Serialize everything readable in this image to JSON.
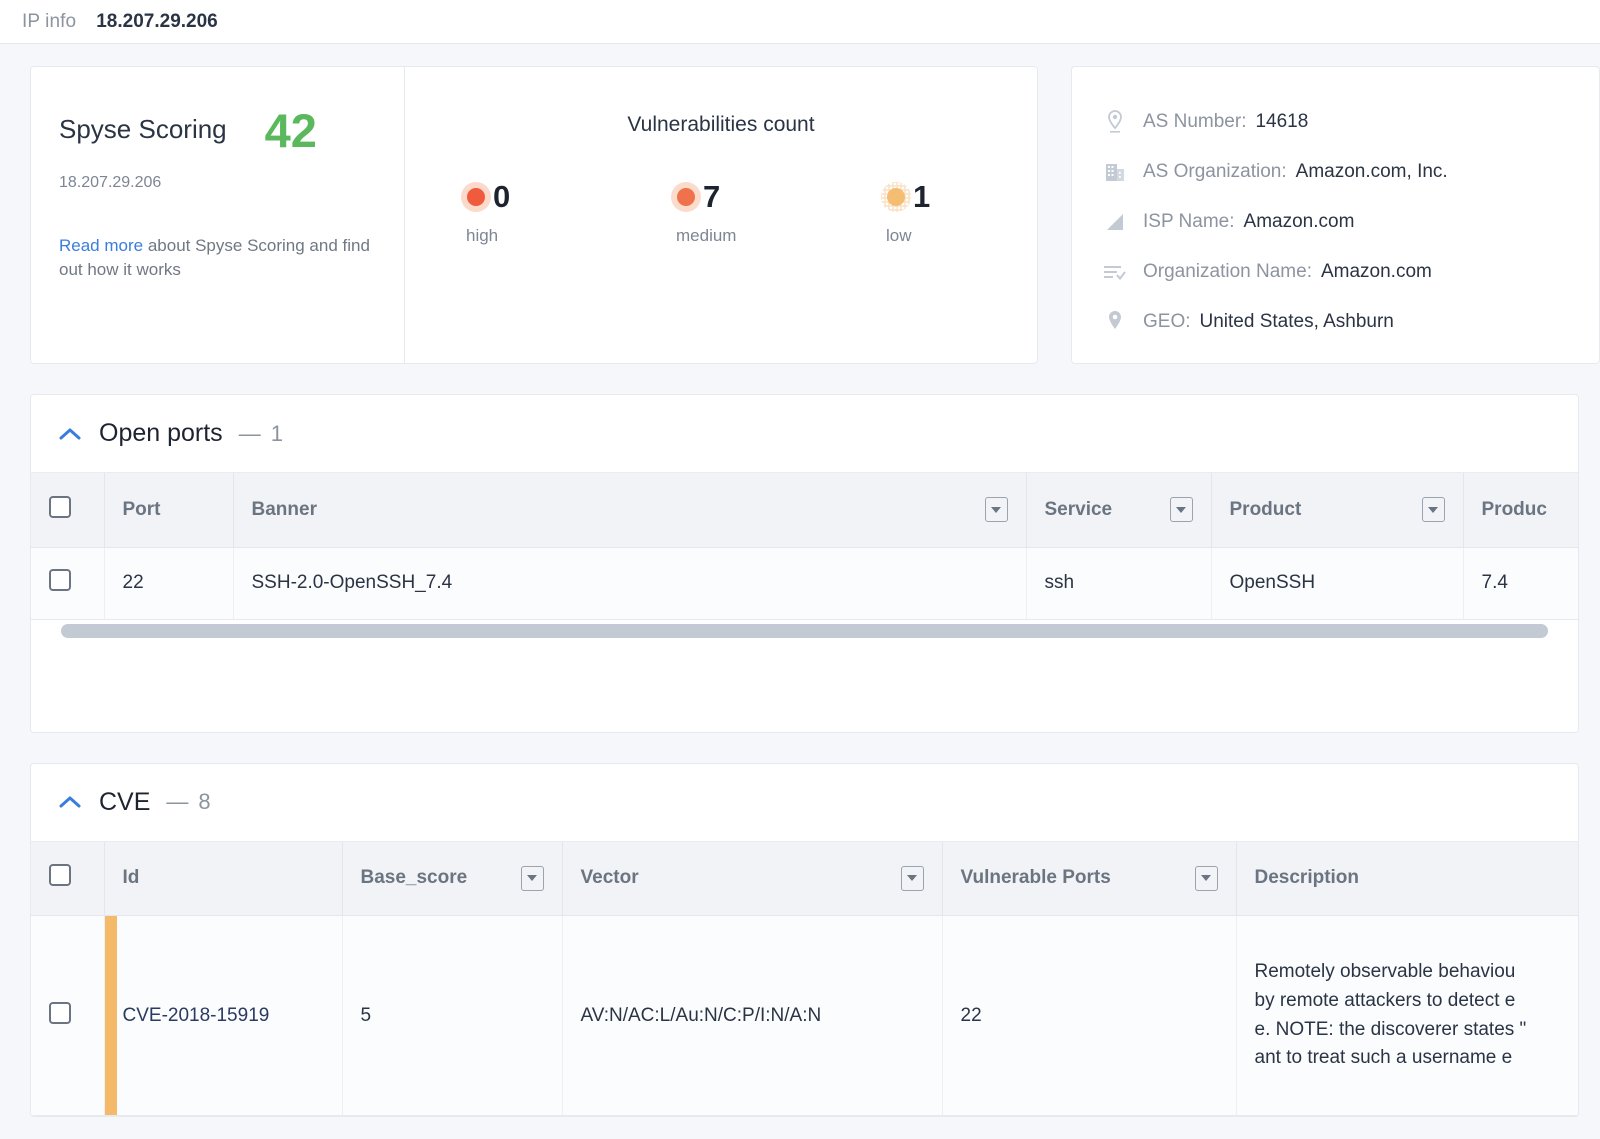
{
  "header": {
    "label": "IP info",
    "ip": "18.207.29.206"
  },
  "scoring": {
    "title": "Spyse Scoring",
    "value": "42",
    "value_color": "#5cb85c",
    "ip": "18.207.29.206",
    "link_text": "Read more",
    "desc_text": " about Spyse Scoring and find out how it works"
  },
  "vulnerabilities": {
    "title": "Vulnerabilities count",
    "items": [
      {
        "count": "0",
        "label": "high",
        "color": "#ef5b3c"
      },
      {
        "count": "7",
        "label": "medium",
        "color": "#f0724c"
      },
      {
        "count": "1",
        "label": "low",
        "color": "#f5bd72"
      }
    ]
  },
  "ip_details": [
    {
      "icon": "map-pin-outline-icon",
      "key": "AS Number:",
      "value": "14618"
    },
    {
      "icon": "building-icon",
      "key": "AS Organization:",
      "value": "Amazon.com, Inc."
    },
    {
      "icon": "signal-triangle-icon",
      "key": "ISP Name:",
      "value": "Amazon.com"
    },
    {
      "icon": "list-check-icon",
      "key": "Organization Name:",
      "value": "Amazon.com"
    },
    {
      "icon": "map-pin-filled-icon",
      "key": "GEO:",
      "value": "United States, Ashburn"
    }
  ],
  "open_ports": {
    "title": "Open ports",
    "dash": "—",
    "count": "1",
    "columns": [
      {
        "label": "",
        "filter": false
      },
      {
        "label": "Port",
        "filter": false
      },
      {
        "label": "Banner",
        "filter": true
      },
      {
        "label": "Service",
        "filter": true
      },
      {
        "label": "Product",
        "filter": true
      },
      {
        "label": "Produc",
        "filter": false
      }
    ],
    "rows": [
      {
        "port": "22",
        "banner": "SSH-2.0-OpenSSH_7.4",
        "service": "ssh",
        "product": "OpenSSH",
        "product_version": "7.4"
      }
    ]
  },
  "cve": {
    "title": "CVE",
    "dash": "—",
    "count": "8",
    "columns": [
      {
        "label": "",
        "filter": false
      },
      {
        "label": "Id",
        "filter": false
      },
      {
        "label": "Base_score",
        "filter": true
      },
      {
        "label": "Vector",
        "filter": true
      },
      {
        "label": "Vulnerable Ports",
        "filter": true
      },
      {
        "label": "Description",
        "filter": false
      }
    ],
    "rows": [
      {
        "id": "CVE-2018-15919",
        "base_score": "5",
        "vector": "AV:N/AC:L/Au:N/C:P/I:N/A:N",
        "vulnerable_ports": "22",
        "severity_color": "#f5b96a",
        "description_lines": [
          "Remotely observable behaviou",
          "by remote attackers to detect e",
          "e. NOTE: the discoverer states \"",
          "ant to treat such a username e"
        ]
      }
    ]
  }
}
